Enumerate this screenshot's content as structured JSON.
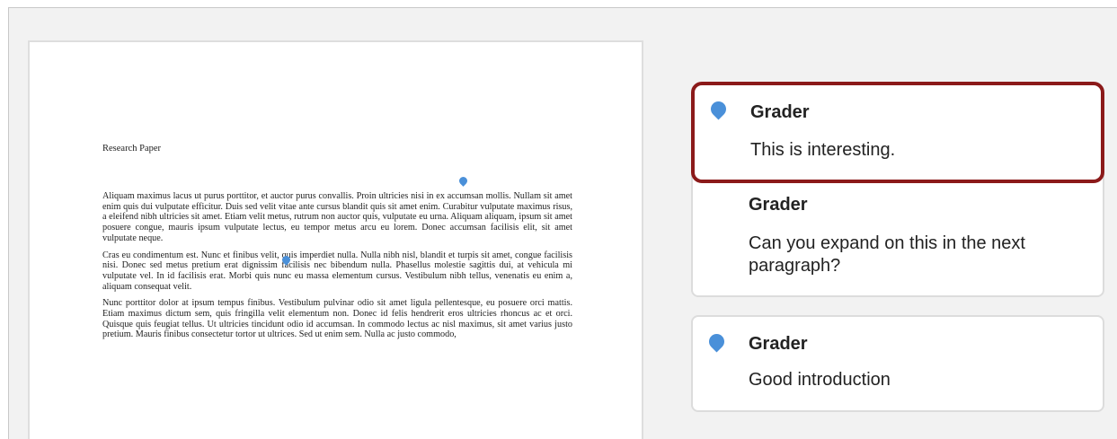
{
  "document": {
    "title": "Research Paper",
    "paragraphs": [
      "Aliquam maximus lacus ut purus porttitor, et auctor purus convallis. Proin ultricies nisi in ex accumsan mollis. Nullam sit amet enim quis dui vulputate efficitur. Duis sed velit vitae ante cursus blandit quis sit amet enim. Curabitur vulputate maximus risus, a eleifend nibh ultricies sit amet. Etiam velit metus, rutrum non auctor quis, vulputate eu urna. Aliquam aliquam, ipsum sit amet posuere congue, mauris ipsum vulputate lectus, eu tempor metus arcu eu lorem. Donec accumsan facilisis elit, sit amet vulputate neque.",
      "Cras eu condimentum est. Nunc et finibus velit, quis imperdiet nulla. Nulla nibh nisl, blandit et turpis sit amet, congue facilisis nisi. Donec sed metus pretium erat dignissim facilisis nec bibendum nulla. Phasellus molestie sagittis dui, at vehicula mi vulputate vel. In id facilisis erat. Morbi quis nunc eu massa elementum cursus. Vestibulum nibh tellus, venenatis eu enim a, aliquam consequat velit.",
      "Nunc porttitor dolor at ipsum tempus finibus. Vestibulum pulvinar odio sit amet ligula pellentesque, eu posuere orci mattis. Etiam maximus dictum sem, quis fringilla velit elementum non. Donec id felis hendrerit eros ultricies rhoncus ac et orci. Quisque quis feugiat tellus. Ut ultricies tincidunt odio id accumsan. In commodo lectus ac nisl maximus, sit amet varius justo pretium. Mauris finibus consectetur tortor ut ultrices. Sed ut enim sem. Nulla ac justo commodo,"
    ]
  },
  "comments": [
    {
      "author": "Grader",
      "text": "This is interesting."
    },
    {
      "author": "Grader",
      "text": "Can you expand on this in the next paragraph?"
    },
    {
      "author": "Grader",
      "text": "Good introduction"
    }
  ],
  "colors": {
    "pin": "#4a90d9",
    "active_border": "#8b1a1a"
  },
  "icons": {
    "annotation_pin": "map-pin-icon"
  }
}
